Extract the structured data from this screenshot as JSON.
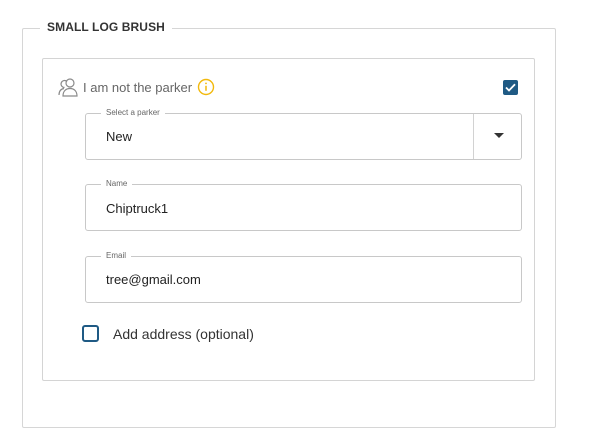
{
  "section": {
    "title": "SMALL LOG BRUSH"
  },
  "parker": {
    "not_parker_label": "I am not the parker",
    "not_parker_checked": true,
    "person_icon": "person-group-icon",
    "info_icon": "info-icon"
  },
  "form": {
    "select_parker": {
      "label": "Select a parker",
      "value": "New"
    },
    "name": {
      "label": "Name",
      "value": "Chiptruck1"
    },
    "email": {
      "label": "Email",
      "value": "tree@gmail.com"
    },
    "add_address": {
      "label": "Add address (optional)",
      "checked": false
    }
  },
  "colors": {
    "accent": "#1f5a84",
    "info": "#f2b90c",
    "icon_gray": "#8a8a8a"
  }
}
